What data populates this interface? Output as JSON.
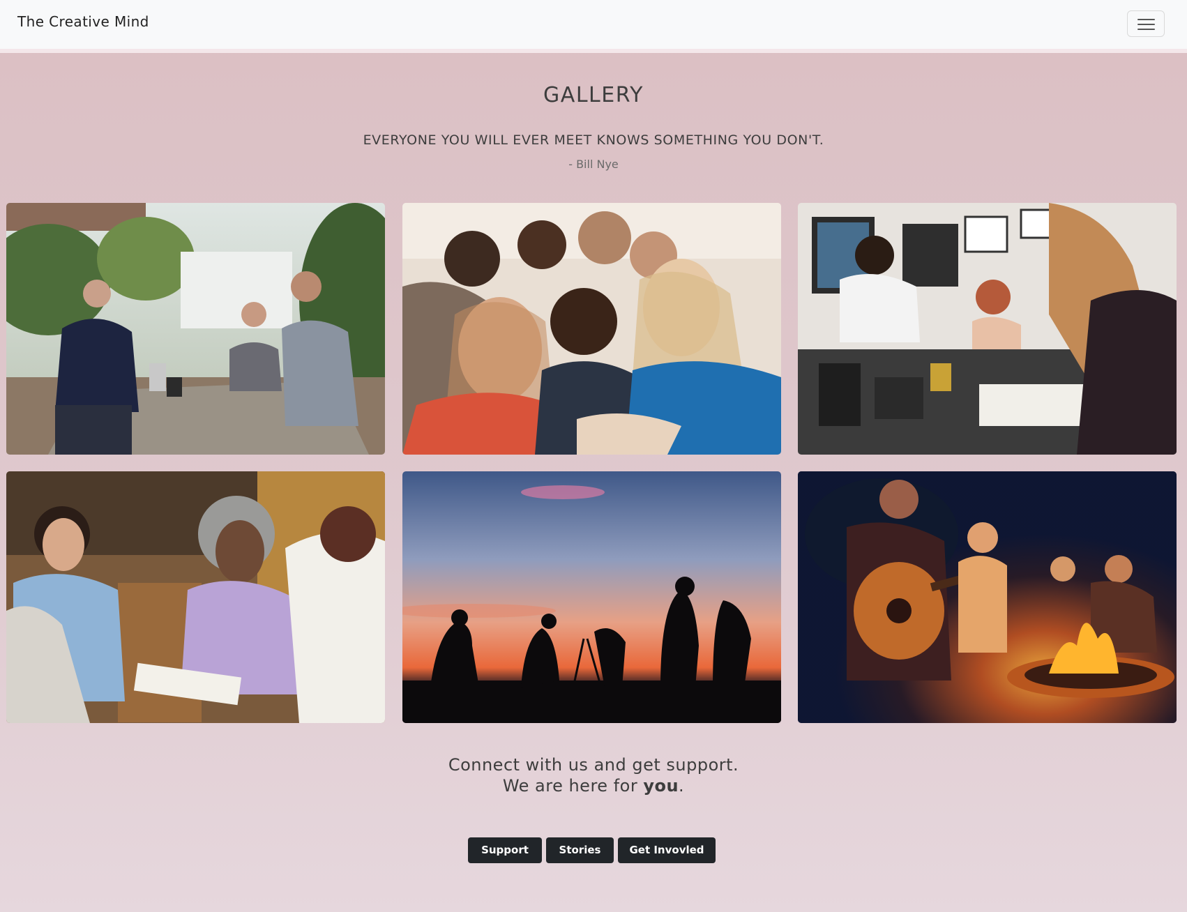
{
  "navbar": {
    "brand": "The Creative Mind",
    "menu_icon": "hamburger-menu-icon"
  },
  "gallery": {
    "title": "GALLERY",
    "quote": "EVERYONE YOU WILL EVER MEET KNOWS SOMETHING YOU DON'T.",
    "author": "- Bill Nye",
    "photos": [
      "outdoor-table-meeting-photo",
      "group-selfie-photo",
      "art-studio-painting-photo",
      "support-group-discussion-photo",
      "sunset-photographers-silhouette-photo",
      "campfire-guitar-photo"
    ]
  },
  "connect": {
    "line1": "Connect with us and get support.",
    "line2_prefix": "We are here for ",
    "line2_emphasis": "you",
    "line2_suffix": "."
  },
  "buttons": {
    "support": "Support",
    "stories": "Stories",
    "get_involved": "Get Invovled"
  },
  "colors": {
    "navbar_bg": "#f8f9fa",
    "page_bg_top": "#dbbfc3",
    "page_bg_bottom": "#e6d7dd",
    "button_bg": "#212529",
    "text": "#3d3d3d"
  }
}
